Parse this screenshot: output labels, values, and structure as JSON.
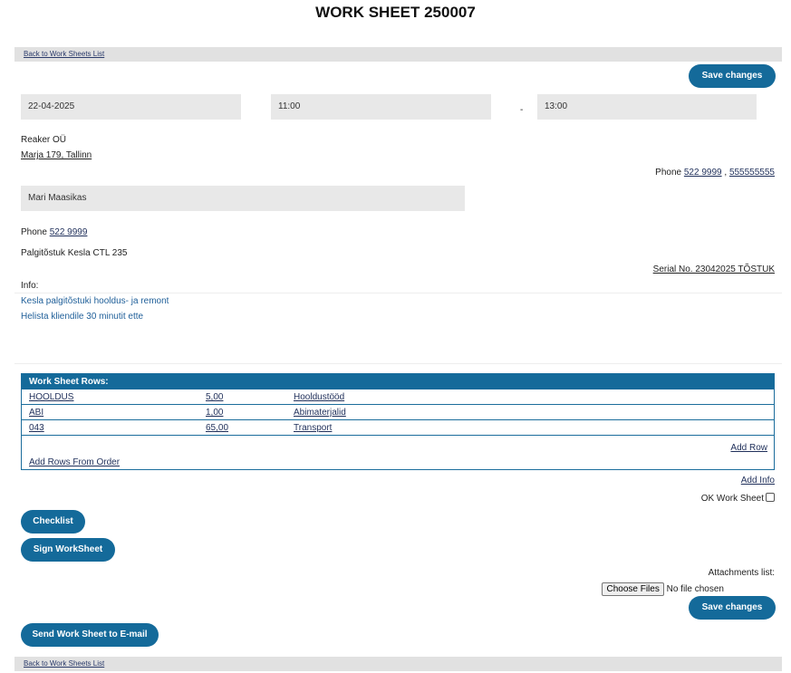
{
  "page": {
    "title": "WORK SHEET 250007"
  },
  "nav": {
    "back_label": "Back to Work Sheets List"
  },
  "actions": {
    "save_label": "Save changes",
    "checklist_label": "Checklist",
    "sign_label": "Sign WorkSheet",
    "send_email_label": "Send Work Sheet to E-mail"
  },
  "schedule": {
    "date": "22-04-2025",
    "start_time": "11:00",
    "separator": "-",
    "end_time": "13:00"
  },
  "client": {
    "name": "Reaker OÜ",
    "address": "Marja 179, Tallinn",
    "phone_prefix": "Phone",
    "phone_1": "522 9999",
    "phone_sep": ",",
    "phone_2": "555555555"
  },
  "contact": {
    "name": "Mari Maasikas",
    "phone_prefix": "Phone",
    "phone": "522 9999"
  },
  "equipment": {
    "name": "Palgitõstuk Kesla CTL 235",
    "serial": "Serial No. 23042025  TÕSTUK"
  },
  "info": {
    "label": "Info:",
    "lines": [
      "Kesla palgitõstuki hooldus- ja remont",
      "Helista kliendile 30 minutit ette"
    ]
  },
  "rows": {
    "header": "Work Sheet Rows:",
    "items": [
      {
        "code": "HOOLDUS",
        "qty": "5,00",
        "desc": "Hooldustööd"
      },
      {
        "code": "ABI",
        "qty": "1,00",
        "desc": "Abimaterjalid"
      },
      {
        "code": "043",
        "qty": "65,00",
        "desc": "Transport"
      }
    ],
    "add_row_label": "Add Row",
    "add_from_order_label": "Add Rows From Order"
  },
  "add_info_label": "Add Info",
  "ok_label": "OK Work Sheet",
  "ok_checked": false,
  "attachments": {
    "label": "Attachments list:",
    "choose_label": "Choose Files",
    "no_file_label": "No file chosen"
  },
  "colors": {
    "accent": "#146a9a",
    "bar": "#e1e1e1",
    "field": "#e8e8e8",
    "info_text": "#1f5f99"
  }
}
